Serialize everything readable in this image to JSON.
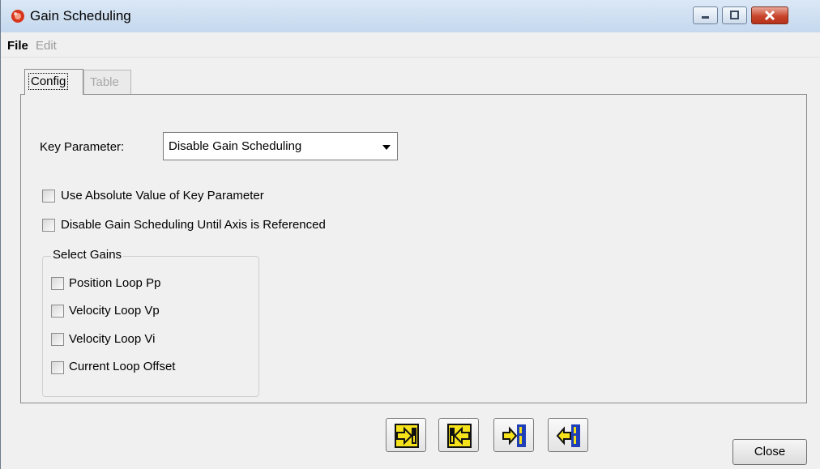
{
  "window": {
    "title": "Gain Scheduling",
    "icon": "app-red-orb-icon",
    "controls": [
      "minimize-icon",
      "maximize-icon",
      "close-icon"
    ]
  },
  "menu": {
    "file": "File",
    "edit": "Edit"
  },
  "tabs": {
    "config": "Config",
    "table": "Table",
    "active": "Config"
  },
  "config": {
    "key_parameter_label": "Key Parameter:",
    "key_parameter_value": "Disable Gain Scheduling",
    "use_absolute_label": "Use Absolute Value of Key Parameter",
    "use_absolute_checked": false,
    "disable_until_ref_label": "Disable Gain Scheduling Until Axis is Referenced",
    "disable_until_ref_checked": false
  },
  "gains": {
    "title": "Select Gains",
    "items": [
      {
        "label": "Position Loop Pp",
        "checked": false
      },
      {
        "label": "Velocity Loop Vp",
        "checked": false
      },
      {
        "label": "Velocity Loop Vi",
        "checked": false
      },
      {
        "label": "Current Loop Offset",
        "checked": false
      }
    ]
  },
  "toolbar": {
    "buttons": [
      "import-right-icon",
      "export-left-icon",
      "import-right-bar-icon",
      "export-left-bar-icon"
    ]
  },
  "footer": {
    "close_label": "Close"
  },
  "colors": {
    "title_gradient_top": "#dbe8f6",
    "close_button_red": "#c8452c",
    "icon_yellow": "#f5e21a",
    "icon_blue": "#1f3fb8"
  }
}
